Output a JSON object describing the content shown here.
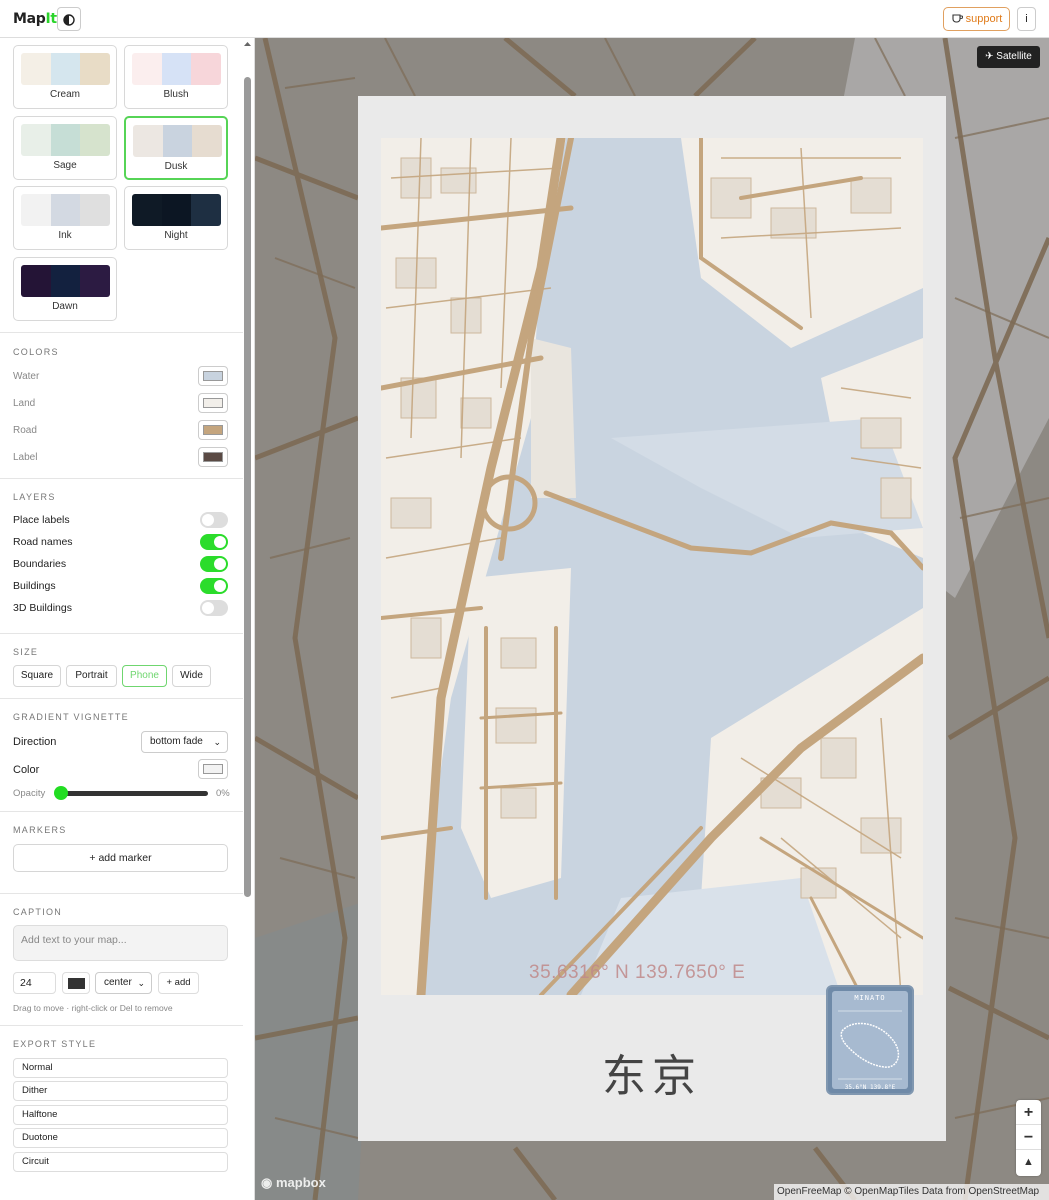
{
  "app": {
    "logo_prefix": "Map",
    "logo_accent": "It",
    "theme_icon": "half-circle-icon"
  },
  "header": {
    "support_label": "support",
    "info_label": "i"
  },
  "themes": [
    {
      "name": "Cream",
      "colors": [
        "#f4efe6",
        "#d5e6ee",
        "#e8dcc6"
      ],
      "active": false
    },
    {
      "name": "Blush",
      "colors": [
        "#fbeeee",
        "#d6e2f6",
        "#f7d6da"
      ],
      "active": false
    },
    {
      "name": "Sage",
      "colors": [
        "#e8efe8",
        "#c6ded6",
        "#d6e3cd"
      ],
      "active": false
    },
    {
      "name": "Dusk",
      "colors": [
        "#ece7e2",
        "#c9d3df",
        "#e6dcd0"
      ],
      "active": true
    },
    {
      "name": "Ink",
      "colors": [
        "#f2f2f2",
        "#d3d9e2",
        "#dfdfdf"
      ],
      "active": false
    },
    {
      "name": "Night",
      "colors": [
        "#0f1a26",
        "#0c1623",
        "#1e2f42"
      ],
      "active": false
    },
    {
      "name": "Dawn",
      "colors": [
        "#241436",
        "#13213f",
        "#2c1b42"
      ],
      "active": false
    }
  ],
  "colors": {
    "title": "COLORS",
    "rows": [
      {
        "label": "Water",
        "value": "#c8d3df"
      },
      {
        "label": "Land",
        "value": "#f2efea"
      },
      {
        "label": "Road",
        "value": "#c4a57e"
      },
      {
        "label": "Label",
        "value": "#5a4a44"
      }
    ]
  },
  "layers": {
    "title": "LAYERS",
    "items": [
      {
        "label": "Place labels",
        "on": false
      },
      {
        "label": "Road names",
        "on": true
      },
      {
        "label": "Boundaries",
        "on": true
      },
      {
        "label": "Buildings",
        "on": true
      },
      {
        "label": "3D Buildings",
        "on": false
      }
    ]
  },
  "size": {
    "title": "SIZE",
    "options": [
      "Square",
      "Portrait",
      "Phone",
      "Wide"
    ],
    "selected": "Phone"
  },
  "vignette": {
    "title": "GRADIENT VIGNETTE",
    "direction_label": "Direction",
    "direction_value": "bottom fade",
    "color_label": "Color",
    "color_value": "#f2f2f2",
    "opacity_label": "Opacity",
    "opacity_value": "0%"
  },
  "markers": {
    "title": "MARKERS",
    "add_label": "+ add marker"
  },
  "caption": {
    "title": "CAPTION",
    "placeholder": "Add text to your map...",
    "font_size": "24",
    "text_color": "#333333",
    "align": "center",
    "add_label": "+ add",
    "hint": "Drag to move · right-click or Del to remove"
  },
  "export": {
    "title": "EXPORT STYLE",
    "items": [
      "Normal",
      "Dither",
      "Halftone",
      "Duotone",
      "Circuit"
    ]
  },
  "map": {
    "satellite_label": "Satellite",
    "coords_text": "35.6316° N 139.7650° E",
    "city_name": "东京",
    "badge_title": "MINATO",
    "badge_coords": "35.6°N 139.8°E",
    "zoom_in": "+",
    "zoom_out": "−",
    "compass": "▲",
    "mapbox_label": "mapbox",
    "attribution": "OpenFreeMap © OpenMapTiles Data from OpenStreetMap"
  }
}
